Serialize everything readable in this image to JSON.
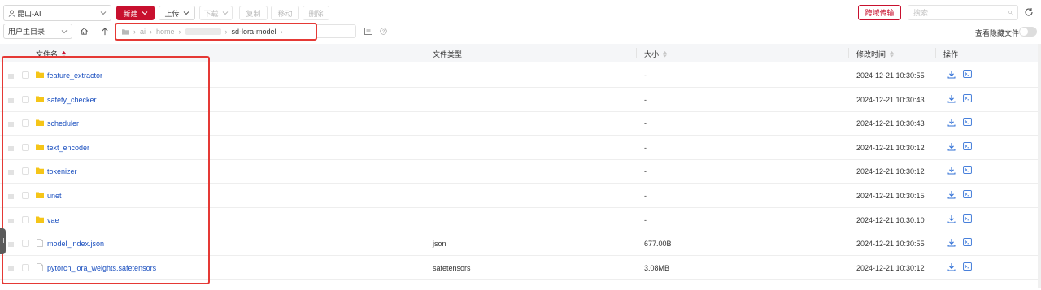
{
  "toolbar": {
    "server": "昆山-AI",
    "new_label": "新建",
    "upload_label": "上传",
    "download_label": "下载",
    "copy_label": "复制",
    "move_label": "移动",
    "delete_label": "删除",
    "transfer_label": "跨域传输",
    "search_placeholder": "搜索"
  },
  "path_bar": {
    "root_dir": "用户主目录",
    "breadcrumb": [
      "ai",
      "home",
      "sd-lora-model"
    ],
    "show_hidden_label": "查看隐藏文件",
    "show_hidden": false
  },
  "table": {
    "columns": {
      "name": "文件名",
      "type": "文件类型",
      "size": "大小",
      "modified": "修改时间",
      "actions": "操作"
    },
    "rows": [
      {
        "name": "feature_extractor",
        "kind": "folder",
        "type": "",
        "size": "-",
        "modified": "2024-12-21 10:30:55"
      },
      {
        "name": "safety_checker",
        "kind": "folder",
        "type": "",
        "size": "-",
        "modified": "2024-12-21 10:30:43"
      },
      {
        "name": "scheduler",
        "kind": "folder",
        "type": "",
        "size": "-",
        "modified": "2024-12-21 10:30:43"
      },
      {
        "name": "text_encoder",
        "kind": "folder",
        "type": "",
        "size": "-",
        "modified": "2024-12-21 10:30:12"
      },
      {
        "name": "tokenizer",
        "kind": "folder",
        "type": "",
        "size": "-",
        "modified": "2024-12-21 10:30:12"
      },
      {
        "name": "unet",
        "kind": "folder",
        "type": "",
        "size": "-",
        "modified": "2024-12-21 10:30:15"
      },
      {
        "name": "vae",
        "kind": "folder",
        "type": "",
        "size": "-",
        "modified": "2024-12-21 10:30:10"
      },
      {
        "name": "model_index.json",
        "kind": "file",
        "type": "json",
        "size": "677.00B",
        "modified": "2024-12-21 10:30:55"
      },
      {
        "name": "pytorch_lora_weights.safetensors",
        "kind": "file",
        "type": "safetensors",
        "size": "3.08MB",
        "modified": "2024-12-21 10:30:12"
      }
    ]
  },
  "colors": {
    "primary": "#c8102e",
    "link": "#1a4fbf",
    "folder": "#f5c518",
    "highlight": "#e53935",
    "action_icon": "#2f6fd6"
  },
  "icons": [
    "user-icon",
    "chevron-down-icon",
    "home-icon",
    "arrow-up-icon",
    "folder-icon",
    "file-icon",
    "search-icon",
    "refresh-icon",
    "download-icon",
    "preview-icon",
    "drag-handle-icon",
    "sort-icon"
  ]
}
